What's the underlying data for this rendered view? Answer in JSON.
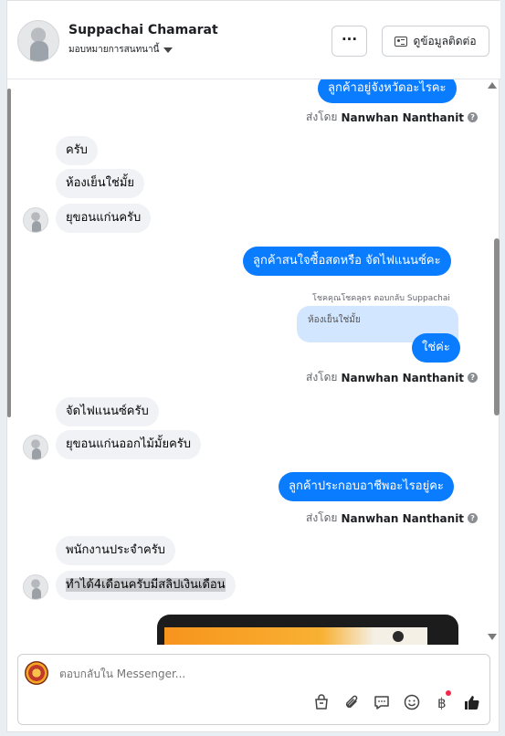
{
  "header": {
    "contact_name": "Suppachai Chamarat",
    "assign_label": "มอบหมายการสนทนานี้",
    "more_label": "···",
    "contact_info_label": "ดูข้อมูลติดต่อ"
  },
  "thread": {
    "messages": [
      {
        "dir": "out",
        "text": "ลูกค้าอยู่จังหวัดอะไรคะ"
      },
      {
        "dir": "meta",
        "prefix": "ส่งโดย",
        "sender": "Nanwhan Nanthanit"
      },
      {
        "dir": "in",
        "text": "ครับ"
      },
      {
        "dir": "in",
        "text": "ห้องเย็นใช่มั้ย"
      },
      {
        "dir": "in",
        "text": "ยุขอนแก่นครับ"
      },
      {
        "dir": "out",
        "text": "ลูกค้าสนใจซื้อสดหรือ จัดไฟแนนซ์คะ"
      },
      {
        "dir": "reply_note",
        "text": "โชคคุณโชคลุดร ตอบกลับ Suppachai"
      },
      {
        "dir": "quote",
        "text": "ห้องเย็นใช่มั้ย"
      },
      {
        "dir": "out",
        "text": "ใช่ค่ะ"
      },
      {
        "dir": "meta",
        "prefix": "ส่งโดย",
        "sender": "Nanwhan Nanthanit"
      },
      {
        "dir": "in",
        "text": "จัดไฟแนนซ์ครับ"
      },
      {
        "dir": "in",
        "text": "ยุขอนแก่นออกไม้มั้ยครับ"
      },
      {
        "dir": "out",
        "text": "ลูกค้าประกอบอาชีพอะไรอยู่คะ"
      },
      {
        "dir": "meta",
        "prefix": "ส่งโดย",
        "sender": "Nanwhan Nanthanit"
      },
      {
        "dir": "in",
        "text": "พนักงานประจำครับ"
      },
      {
        "dir": "in",
        "text": "ทำได้4เดือนครับมีสลิปเงินเดือน"
      }
    ]
  },
  "composer": {
    "placeholder": "ตอบกลับใน Messenger..."
  },
  "icons": {
    "tools": [
      "bag-icon",
      "attachment-icon",
      "comment-icon",
      "emoji-icon",
      "baht-icon",
      "like-icon"
    ]
  },
  "colors": {
    "outgoing_bubble": "#0a7cff",
    "incoming_bubble": "#f0f2f5",
    "quote_bubble": "#d3e6ff"
  }
}
